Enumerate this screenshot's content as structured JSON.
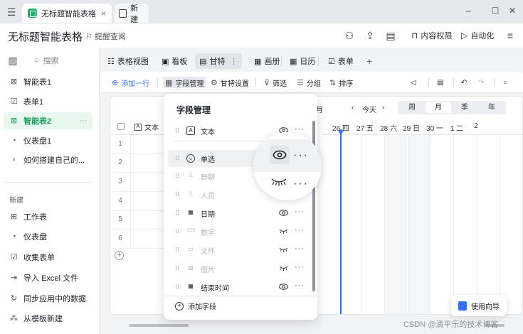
{
  "browser_tabs": [
    {
      "label": "无标题智能表格",
      "close": "×"
    },
    {
      "label": "新建"
    }
  ],
  "window_controls": [
    "–",
    "☐",
    "✕"
  ],
  "header": {
    "title": "无标题智能表格",
    "remind": "提醒查阅",
    "permission": "内容权限",
    "automation": "自动化"
  },
  "sidebar": {
    "search_placeholder": "搜索",
    "items": [
      {
        "label": "智能表1",
        "icon": "smart-table-icon"
      },
      {
        "label": "表单1",
        "icon": "form-icon"
      },
      {
        "label": "智能表2",
        "icon": "smart-table-icon",
        "active": true,
        "more": "···"
      },
      {
        "label": "仪表盘1",
        "icon": "dashboard-icon"
      },
      {
        "label": "如何搭建自己的...",
        "icon": "bulb-icon"
      }
    ],
    "new_section": "新建",
    "new_items": [
      {
        "label": "工作表"
      },
      {
        "label": "仪表盘"
      },
      {
        "label": "收集表单"
      },
      {
        "label": "导入 Excel 文件"
      },
      {
        "label": "同步应用中的数据"
      },
      {
        "label": "从模板新建"
      }
    ]
  },
  "view_tabs": [
    {
      "label": "表格视图"
    },
    {
      "label": "看板"
    },
    {
      "label": "甘特",
      "active": true
    },
    {
      "label": "画册"
    },
    {
      "label": "日历"
    },
    {
      "label": "表单"
    }
  ],
  "toolbar": {
    "add_row": "添加一行",
    "field_manage": "字段管理",
    "gantt_settings": "甘特设置",
    "filter": "筛选",
    "group": "分组",
    "sort": "排序"
  },
  "grid": {
    "text_col": "文本",
    "rows": [
      "1",
      "2",
      "3",
      "4",
      "5",
      "6"
    ]
  },
  "gantt": {
    "month": "月",
    "today": "今天",
    "scales": [
      "周",
      "月",
      "季",
      "年"
    ],
    "active_scale": "月",
    "days": [
      "26 四",
      "27 五",
      "28 六",
      "29 日",
      "30 一",
      "1 二",
      "2"
    ]
  },
  "field_panel": {
    "title": "字段管理",
    "fields": [
      {
        "label": "文本",
        "type_glyph": "A",
        "visible": true
      },
      {
        "label": "单选",
        "type_glyph": "⌄",
        "visible": true
      },
      {
        "label": "群聊",
        "type_glyph": "♙",
        "visible": false
      },
      {
        "label": "人员",
        "type_glyph": "♙",
        "visible": false
      },
      {
        "label": "日期",
        "type_glyph": "▦",
        "visible": true
      },
      {
        "label": "数字",
        "type_glyph": "123",
        "visible": false
      },
      {
        "label": "文件",
        "type_glyph": "▭",
        "visible": false
      },
      {
        "label": "图片",
        "type_glyph": "▨",
        "visible": false
      },
      {
        "label": "结束时间",
        "type_glyph": "▦",
        "visible": true
      }
    ],
    "add_field": "添加字段",
    "more": "···"
  },
  "guide": {
    "label": "使用向导"
  },
  "watermark": "CSDN @清平乐的技术博客"
}
